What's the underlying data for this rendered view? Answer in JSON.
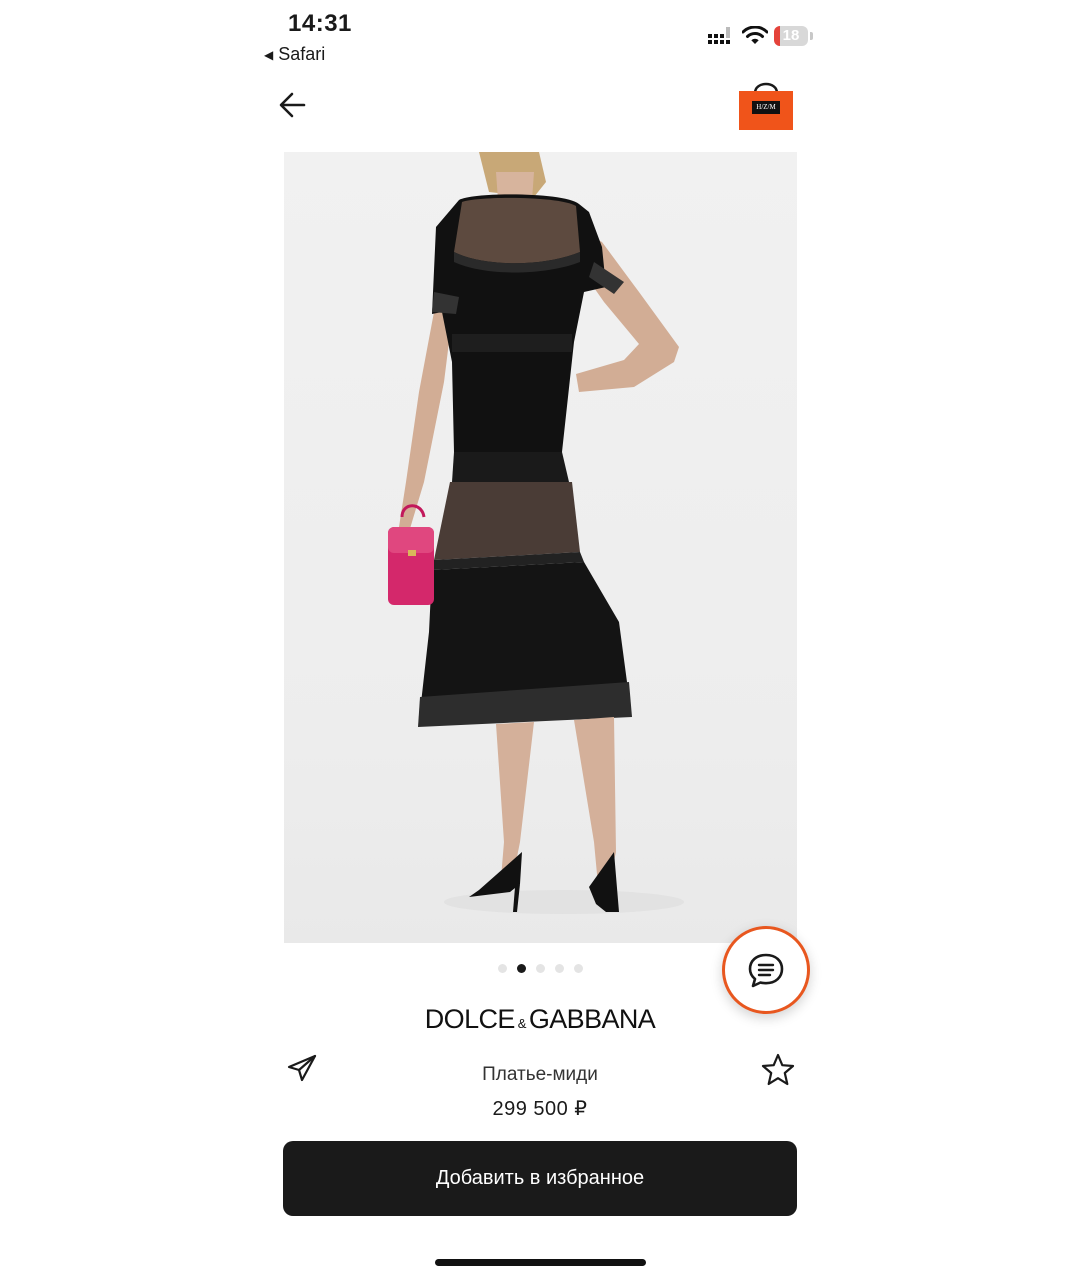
{
  "status_bar": {
    "time": "14:31",
    "back_app": "Safari",
    "battery": "18",
    "battery_level": 0.18
  },
  "nav": {
    "back_icon": "arrow-left-icon",
    "cart_icon": "shopping-bag-icon",
    "cart_logo_text": "H/Z/M"
  },
  "gallery": {
    "image_count": 5,
    "active_index": 1
  },
  "product": {
    "brand": "DOLCE",
    "brand_amp": "&",
    "brand_second": "GABBANA",
    "name": "Платье-миди",
    "price": "299 500 ₽"
  },
  "actions": {
    "share_icon": "telegram-send-icon",
    "favorite_icon": "star-outline-icon",
    "chat_icon": "chat-bubble-icon",
    "add_favorite_label": "Добавить в избранное"
  },
  "colors": {
    "accent": "#e8571f",
    "button_bg": "#1a1a1a"
  }
}
